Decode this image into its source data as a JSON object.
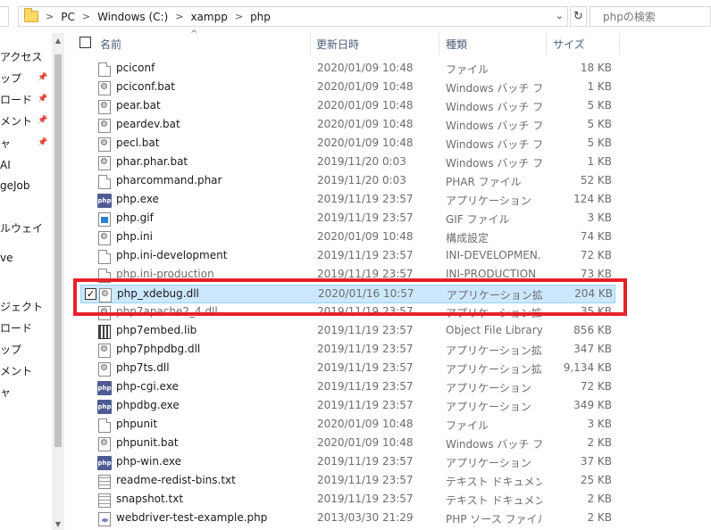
{
  "address": {
    "crumbs": [
      "PC",
      "Windows (C:)",
      "xampp",
      "php"
    ],
    "search_placeholder": "phpの検索",
    "refresh_icon": "refresh-icon"
  },
  "nav": {
    "items": [
      {
        "label": "アクセス",
        "pinned": false
      },
      {
        "label": "ップ",
        "pinned": true
      },
      {
        "label": "ロード",
        "pinned": true
      },
      {
        "label": "メント",
        "pinned": true
      },
      {
        "label": "ャ",
        "pinned": true
      },
      {
        "label": "AI",
        "pinned": false
      },
      {
        "label": "geJob",
        "pinned": false
      },
      {
        "label": "",
        "pinned": false
      },
      {
        "label": "ルウェイ",
        "pinned": false
      },
      {
        "label": "",
        "pinned": false
      },
      {
        "label": "ve",
        "pinned": false
      },
      {
        "label": "",
        "pinned": false
      },
      {
        "label": "",
        "pinned": false
      },
      {
        "label": "ジェクト",
        "pinned": false
      },
      {
        "label": "ロード",
        "pinned": false
      },
      {
        "label": "ップ",
        "pinned": false
      },
      {
        "label": "メント",
        "pinned": false
      },
      {
        "label": "ャ",
        "pinned": false
      }
    ]
  },
  "header": {
    "name": "名前",
    "date": "更新日時",
    "type": "種類",
    "size": "サイズ"
  },
  "files": [
    {
      "name": "pciconf",
      "date": "2020/01/09 10:48",
      "type": "ファイル",
      "size": "18 KB",
      "icon": "file"
    },
    {
      "name": "pciconf.bat",
      "date": "2020/01/09 10:48",
      "type": "Windows バッチ ファ...",
      "size": "1 KB",
      "icon": "gear"
    },
    {
      "name": "pear.bat",
      "date": "2020/01/09 10:48",
      "type": "Windows バッチ ファ...",
      "size": "5 KB",
      "icon": "gear"
    },
    {
      "name": "peardev.bat",
      "date": "2020/01/09 10:48",
      "type": "Windows バッチ ファ...",
      "size": "5 KB",
      "icon": "gear"
    },
    {
      "name": "pecl.bat",
      "date": "2020/01/09 10:48",
      "type": "Windows バッチ ファ...",
      "size": "5 KB",
      "icon": "gear"
    },
    {
      "name": "phar.phar.bat",
      "date": "2019/11/20 0:03",
      "type": "Windows バッチ ファ...",
      "size": "1 KB",
      "icon": "gear"
    },
    {
      "name": "pharcommand.phar",
      "date": "2019/11/20 0:03",
      "type": "PHAR ファイル",
      "size": "52 KB",
      "icon": "file"
    },
    {
      "name": "php.exe",
      "date": "2019/11/19 23:57",
      "type": "アプリケーション",
      "size": "124 KB",
      "icon": "php"
    },
    {
      "name": "php.gif",
      "date": "2019/11/19 23:57",
      "type": "GIF ファイル",
      "size": "3 KB",
      "icon": "gif"
    },
    {
      "name": "php.ini",
      "date": "2020/01/09 10:48",
      "type": "構成設定",
      "size": "74 KB",
      "icon": "gear"
    },
    {
      "name": "php.ini-development",
      "date": "2019/11/19 23:57",
      "type": "INI-DEVELOPMEN...",
      "size": "72 KB",
      "icon": "file"
    },
    {
      "name": "php.ini-production",
      "date": "2019/11/19 23:57",
      "type": "INI-PRODUCTION",
      "size": "73 KB",
      "icon": "file",
      "clipped": true
    },
    {
      "name": "php_xdebug.dll",
      "date": "2020/01/16 10:57",
      "type": "アプリケーション拡張",
      "size": "204 KB",
      "icon": "gear",
      "selected": true
    },
    {
      "name": "php7apache2_4.dll",
      "date": "2019/11/19 23:57",
      "type": "アプリケーション拡張",
      "size": "35 KB",
      "icon": "gear",
      "clipped": true
    },
    {
      "name": "php7embed.lib",
      "date": "2019/11/19 23:57",
      "type": "Object File Library",
      "size": "856 KB",
      "icon": "lib"
    },
    {
      "name": "php7phpdbg.dll",
      "date": "2019/11/19 23:57",
      "type": "アプリケーション拡張",
      "size": "347 KB",
      "icon": "gear"
    },
    {
      "name": "php7ts.dll",
      "date": "2019/11/19 23:57",
      "type": "アプリケーション拡張",
      "size": "9,134 KB",
      "icon": "gear"
    },
    {
      "name": "php-cgi.exe",
      "date": "2019/11/19 23:57",
      "type": "アプリケーション",
      "size": "72 KB",
      "icon": "php"
    },
    {
      "name": "phpdbg.exe",
      "date": "2019/11/19 23:57",
      "type": "アプリケーション",
      "size": "349 KB",
      "icon": "php"
    },
    {
      "name": "phpunit",
      "date": "2020/01/09 10:48",
      "type": "ファイル",
      "size": "3 KB",
      "icon": "file"
    },
    {
      "name": "phpunit.bat",
      "date": "2020/01/09 10:48",
      "type": "Windows バッチ ファ...",
      "size": "2 KB",
      "icon": "gear"
    },
    {
      "name": "php-win.exe",
      "date": "2019/11/19 23:57",
      "type": "アプリケーション",
      "size": "37 KB",
      "icon": "php"
    },
    {
      "name": "readme-redist-bins.txt",
      "date": "2019/11/19 23:57",
      "type": "テキスト ドキュメント",
      "size": "25 KB",
      "icon": "txt"
    },
    {
      "name": "snapshot.txt",
      "date": "2019/11/19 23:57",
      "type": "テキスト ドキュメント",
      "size": "2 KB",
      "icon": "txt"
    },
    {
      "name": "webdriver-test-example.php",
      "date": "2013/03/30 21:29",
      "type": "PHP ソース ファイル",
      "size": "2 KB",
      "icon": "phpsrc"
    }
  ]
}
